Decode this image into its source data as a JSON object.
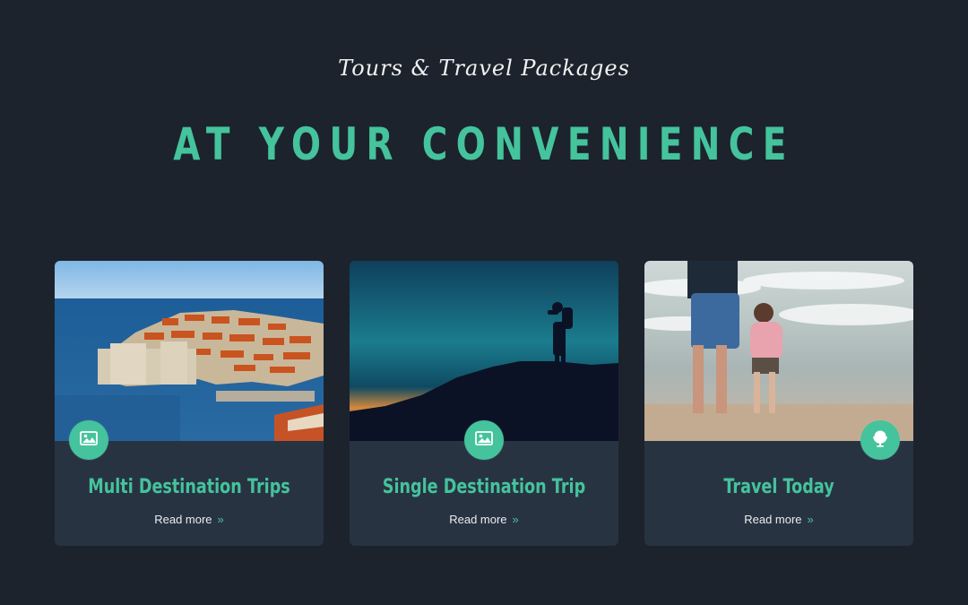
{
  "header": {
    "eyebrow": "Tours & Travel Packages",
    "title": "AT YOUR CONVENIENCE"
  },
  "cards": [
    {
      "title": "Multi Destination Trips",
      "link_label": "Read more",
      "link_arrow": "»",
      "badge_icon": "image-icon"
    },
    {
      "title": "Single Destination Trip",
      "link_label": "Read more",
      "link_arrow": "»",
      "badge_icon": "image-icon"
    },
    {
      "title": "Travel Today",
      "link_label": "Read more",
      "link_arrow": "»",
      "badge_icon": "globe-icon"
    }
  ],
  "colors": {
    "background": "#1c232d",
    "card": "#283342",
    "accent": "#45c39c",
    "text_light": "#e8edf0"
  }
}
